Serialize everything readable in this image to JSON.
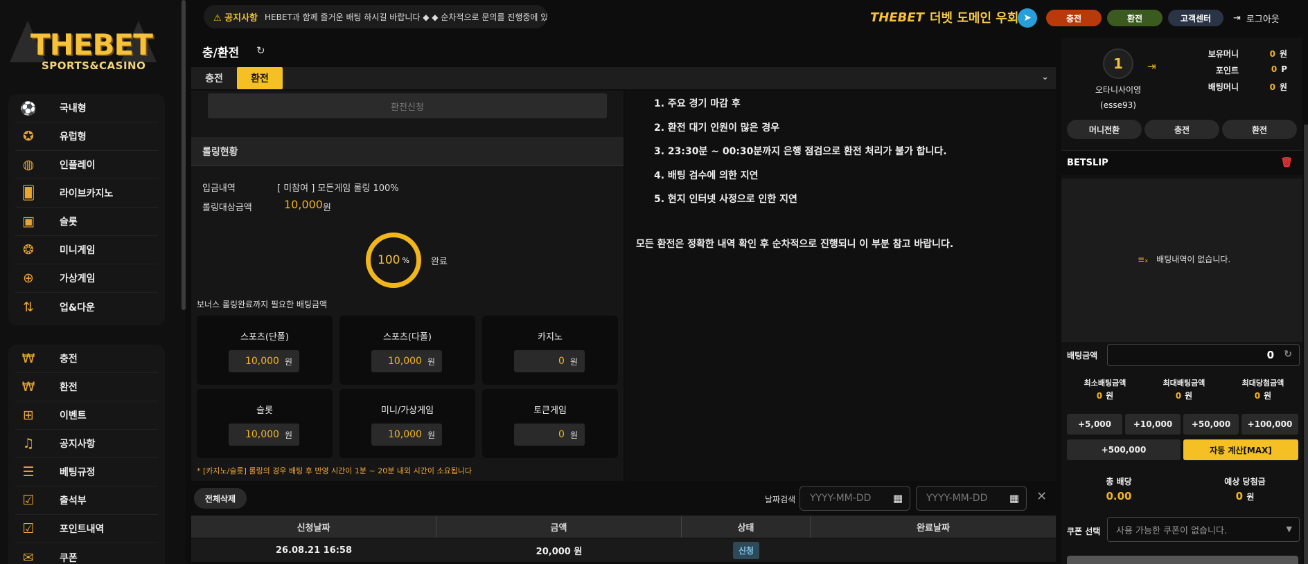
{
  "logo": {
    "main": "THEBET",
    "sub": "SPORTS&CASINO"
  },
  "menu1": [
    {
      "label": "국내형",
      "icon": "soccer-ball-icon",
      "glyph": "⚽"
    },
    {
      "label": "유럽형",
      "icon": "film-reel-icon",
      "glyph": "✪"
    },
    {
      "label": "인플레이",
      "icon": "basketball-icon",
      "glyph": "◍"
    },
    {
      "label": "라이브카지노",
      "icon": "cards-icon",
      "glyph": "🂠"
    },
    {
      "label": "슬롯",
      "icon": "slot-machine-icon",
      "glyph": "▣"
    },
    {
      "label": "미니게임",
      "icon": "bubbles-icon",
      "glyph": "❂"
    },
    {
      "label": "가상게임",
      "icon": "gamepad-icon",
      "glyph": "⊕"
    },
    {
      "label": "업&다운",
      "icon": "updown-icon",
      "glyph": "⇅"
    }
  ],
  "menu2": [
    {
      "label": "충전",
      "icon": "won-coin-icon",
      "glyph": "₩"
    },
    {
      "label": "환전",
      "icon": "money-bag-icon",
      "glyph": "₩"
    },
    {
      "label": "이벤트",
      "icon": "gift-icon",
      "glyph": "⊞"
    },
    {
      "label": "공지사항",
      "icon": "bell-icon",
      "glyph": "♫"
    },
    {
      "label": "베팅규정",
      "icon": "document-search-icon",
      "glyph": "☰"
    },
    {
      "label": "출석부",
      "icon": "calendar-check-icon",
      "glyph": "☑"
    },
    {
      "label": "포인트내역",
      "icon": "clipboard-check-icon",
      "glyph": "☑"
    },
    {
      "label": "쿠폰",
      "icon": "envelope-icon",
      "glyph": "✉"
    }
  ],
  "notice": {
    "badge": "⚠ 공지사항",
    "text": "HEBET과 함께 즐거운 배팅 하시길 바랍니다 ◆ ◆ 순차적으로 문의를 진행중에 있습니"
  },
  "brand": {
    "logo": "THEBET",
    "text": "더벳 도메인 우회"
  },
  "topbar": {
    "deposit": "충전",
    "withdraw": "환전",
    "support": "고객센터",
    "logout": "로그아웃"
  },
  "colors": {
    "deposit": "#b83a0a",
    "withdraw": "#3b5a1f",
    "support": "#2b3446",
    "accent": "#f4c023"
  },
  "page": {
    "title": "충/환전"
  },
  "tabs": [
    "충전",
    "환전"
  ],
  "withdraw": {
    "request_label": "환전신청",
    "rolling_title": "롤링현황",
    "deposit_detail_label": "입금내역",
    "deposit_detail_value": "[ 미참여 ] 모든게임 롤링 100%",
    "rolling_target_label": "롤링대상금액",
    "rolling_target_value": "10,000",
    "unit_won": "원",
    "progress_value": "100",
    "progress_unit": "%",
    "progress_status": "완료",
    "bonus_label": "보너스 롤링완료까지 필요한 배팅금액",
    "cards": [
      {
        "title": "스포츠(단폴)",
        "value": "10,000"
      },
      {
        "title": "스포츠(다폴)",
        "value": "10,000"
      },
      {
        "title": "카지노",
        "value": "0"
      },
      {
        "title": "슬롯",
        "value": "10,000"
      },
      {
        "title": "미니/가상게임",
        "value": "10,000"
      },
      {
        "title": "토큰게임",
        "value": "0"
      }
    ],
    "footnote": "* [카지노/슬롯] 롤링의 경우 배팅 후 반영 시간이 1분 ~ 20분 내외 시간이 소요됩니다"
  },
  "notices_right": [
    "1. 주요 경기 마감 후",
    "2. 환전 대기 인원이 많은 경우",
    "3. 23:30분 ~ 00:30분까지 은행 점검으로 환전 처리가 불가 합니다.",
    "4. 배팅 검수에 의한 지연",
    "5. 현지 인터넷 사정으로 인한 지연"
  ],
  "notice_right_footer": "모든 환전은 정확한 내역 확인 후 순차적으로 진행되니 이 부분 참고 바랍니다.",
  "history": {
    "delete_all": "전체삭제",
    "date_search_label": "날짜검색",
    "date_placeholder": "YYYY-MM-DD",
    "headers": [
      "신청날짜",
      "금액",
      "상태",
      "완료날짜"
    ],
    "rows": [
      {
        "date": "26.08.21 16:58",
        "amount": "20,000 원",
        "status": "신청",
        "done": ""
      }
    ]
  },
  "user": {
    "level": "1",
    "name": "오타니사이영",
    "id": "(esse93)",
    "stats": [
      {
        "k": "보유머니",
        "v": "0",
        "u": "원"
      },
      {
        "k": "포인트",
        "v": "0",
        "u": "P"
      },
      {
        "k": "배팅머니",
        "v": "0",
        "u": "원"
      }
    ],
    "buttons": [
      "머니전환",
      "충전",
      "환전"
    ]
  },
  "betslip": {
    "title": "BETSLIP",
    "empty": "배팅내역이 없습니다.",
    "amount_label": "배팅금액",
    "amount": "0",
    "limits": [
      {
        "k": "최소배팅금액",
        "v": "0",
        "u": "원"
      },
      {
        "k": "최대배팅금액",
        "v": "0",
        "u": "원"
      },
      {
        "k": "최대당첨금액",
        "v": "0",
        "u": "원"
      }
    ],
    "quick": [
      "+5,000",
      "+10,000",
      "+50,000",
      "+100,000"
    ],
    "quick_big": "+500,000",
    "auto_max": "자동 계산[MAX]",
    "total_odds_label": "총 배당",
    "total_odds": "0.00",
    "expected_label": "예상 당첨금",
    "expected": "0",
    "expected_unit": "원",
    "coupon_label": "쿠폰 선택",
    "coupon_placeholder": "사용 가능한 쿠폰이 없습니다."
  }
}
